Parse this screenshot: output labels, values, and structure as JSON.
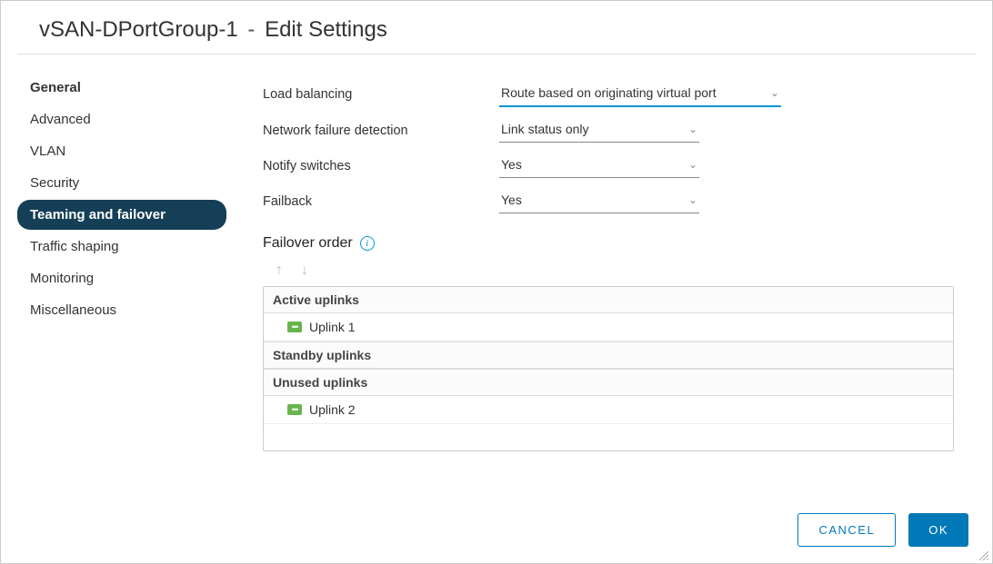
{
  "title": {
    "name": "vSAN-DPortGroup-1",
    "separator": "-",
    "action": "Edit Settings"
  },
  "sidebar": {
    "items": [
      {
        "label": "General",
        "active": false
      },
      {
        "label": "Advanced",
        "active": false
      },
      {
        "label": "VLAN",
        "active": false
      },
      {
        "label": "Security",
        "active": false
      },
      {
        "label": "Teaming and failover",
        "active": true
      },
      {
        "label": "Traffic shaping",
        "active": false
      },
      {
        "label": "Monitoring",
        "active": false
      },
      {
        "label": "Miscellaneous",
        "active": false
      }
    ]
  },
  "form": {
    "load_balancing": {
      "label": "Load balancing",
      "value": "Route based on originating virtual port"
    },
    "failure_detection": {
      "label": "Network failure detection",
      "value": "Link status only"
    },
    "notify_switches": {
      "label": "Notify switches",
      "value": "Yes"
    },
    "failback": {
      "label": "Failback",
      "value": "Yes"
    }
  },
  "failover": {
    "title": "Failover order",
    "groups": {
      "active": {
        "header": "Active uplinks",
        "items": [
          "Uplink 1"
        ]
      },
      "standby": {
        "header": "Standby uplinks",
        "items": []
      },
      "unused": {
        "header": "Unused uplinks",
        "items": [
          "Uplink 2"
        ]
      }
    }
  },
  "buttons": {
    "cancel": "CANCEL",
    "ok": "OK"
  }
}
